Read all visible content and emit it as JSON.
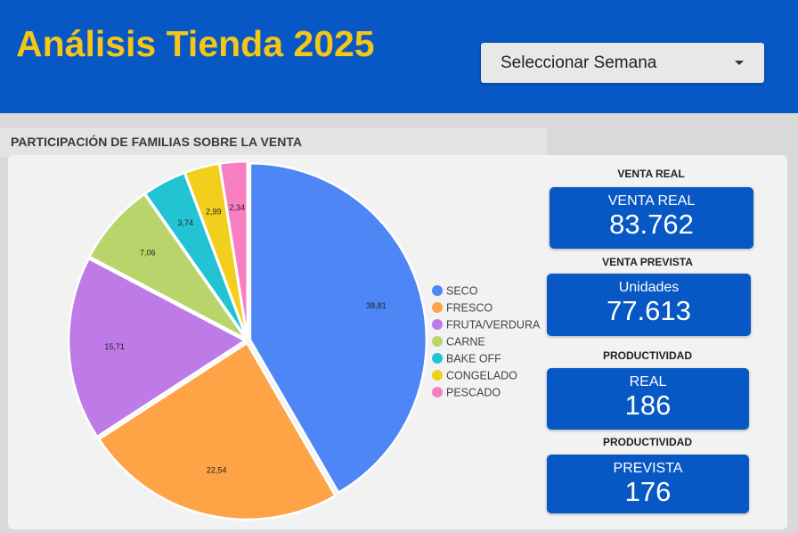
{
  "header": {
    "title": "Análisis Tienda 2025",
    "select_label": "Seleccionar Semana"
  },
  "chart_section": {
    "title": "PARTICIPACIÓN DE FAMILIAS SOBRE LA VENTA"
  },
  "chart_data": {
    "type": "pie",
    "title": "PARTICIPACIÓN DE FAMILIAS SOBRE LA VENTA",
    "categories": [
      "SECO",
      "FRESCO",
      "FRUTA/VERDURA",
      "CARNE",
      "BAKE OFF",
      "CONGELADO",
      "PESCADO"
    ],
    "values": [
      38.81,
      22.54,
      15.71,
      7.06,
      3.74,
      2.99,
      2.34
    ],
    "value_labels": [
      "38,81",
      "22,54",
      "15,71",
      "7,06",
      "3,74",
      "2,99",
      "2,34"
    ],
    "colors": [
      "#4e86f5",
      "#ffa347",
      "#be7be8",
      "#b8d46a",
      "#22c4d4",
      "#f2cf1d",
      "#f77fc1"
    ],
    "legend": "right",
    "exploded": true
  },
  "kpis": [
    {
      "heading": "VENTA REAL",
      "label": "VENTA REAL",
      "value": "83.762"
    },
    {
      "heading": "VENTA PREVISTA",
      "label": "Unidades",
      "value": "77.613"
    },
    {
      "heading": "PRODUCTIVIDAD",
      "label": "REAL",
      "value": "186"
    },
    {
      "heading": "PRODUCTIVIDAD",
      "label": "PREVISTA",
      "value": "176"
    }
  ],
  "icons": {
    "select_arrow": "chevron-down-icon"
  }
}
